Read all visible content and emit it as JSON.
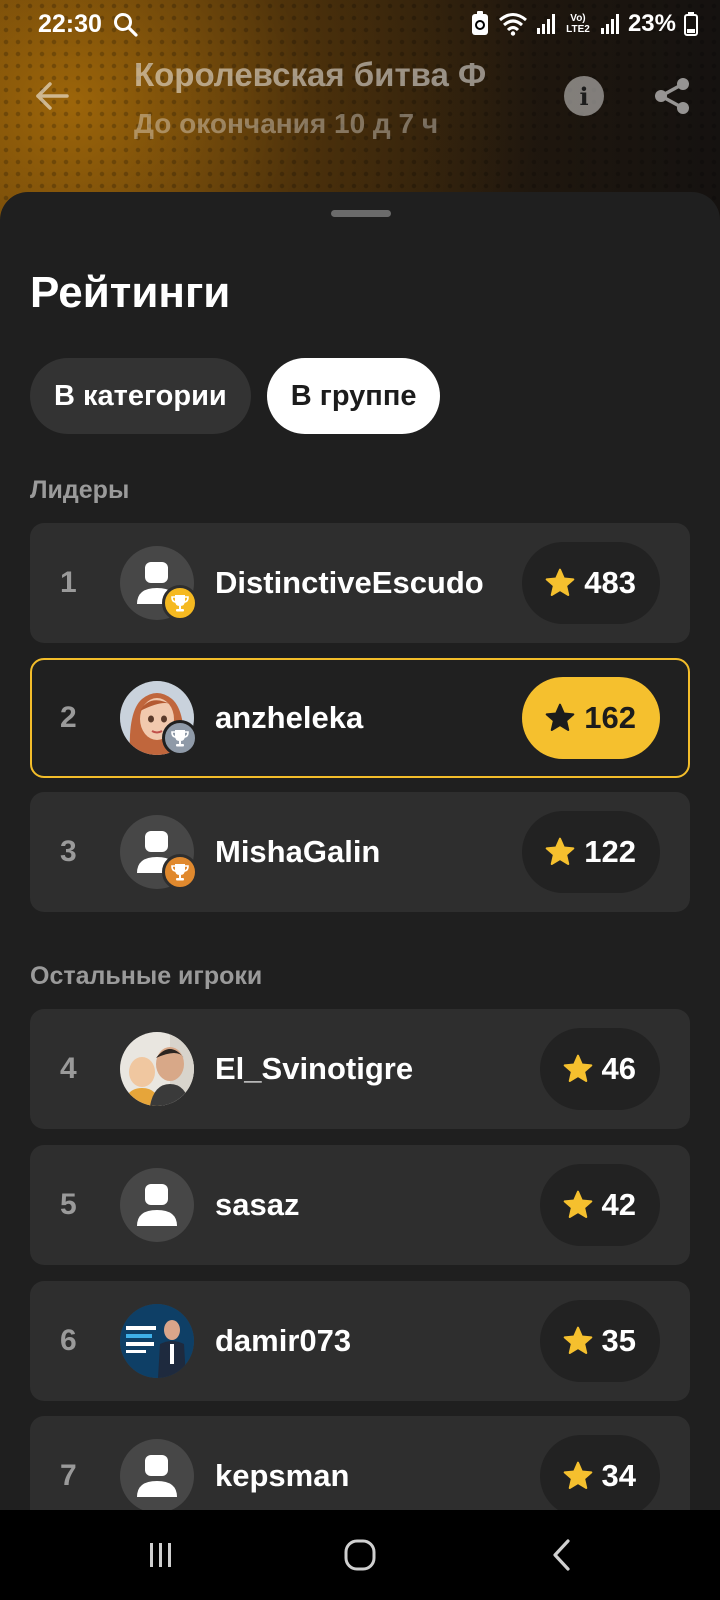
{
  "status_bar": {
    "time": "22:30",
    "battery": "23%",
    "network_label": "Vo) LTE2"
  },
  "header": {
    "title": "Королевская битва Ф",
    "subtitle": "До окончания 10 д 7 ч"
  },
  "sheet": {
    "title": "Рейтинги",
    "tabs": [
      {
        "label": "В категории",
        "active": false
      },
      {
        "label": "В группе",
        "active": true
      }
    ],
    "leaders_label": "Лидеры",
    "others_label": "Остальные игроки",
    "leaders": [
      {
        "rank": "1",
        "name": "DistinctiveEscudo",
        "score": "483",
        "badge": "gold-trophy-icon"
      },
      {
        "rank": "2",
        "name": "anzheleka",
        "score": "162",
        "badge": "silver-trophy-icon",
        "highlighted": true
      },
      {
        "rank": "3",
        "name": "MishaGalin",
        "score": "122",
        "badge": "bronze-trophy-icon"
      }
    ],
    "others": [
      {
        "rank": "4",
        "name": "El_Svinotigre",
        "score": "46"
      },
      {
        "rank": "5",
        "name": "sasaz",
        "score": "42"
      },
      {
        "rank": "6",
        "name": "damir073",
        "score": "35"
      },
      {
        "rank": "7",
        "name": "kepsman",
        "score": "34"
      }
    ]
  },
  "colors": {
    "accent": "#f5c02e",
    "sheet_bg": "#1f1f1f",
    "row_bg": "#2e2e2e"
  }
}
